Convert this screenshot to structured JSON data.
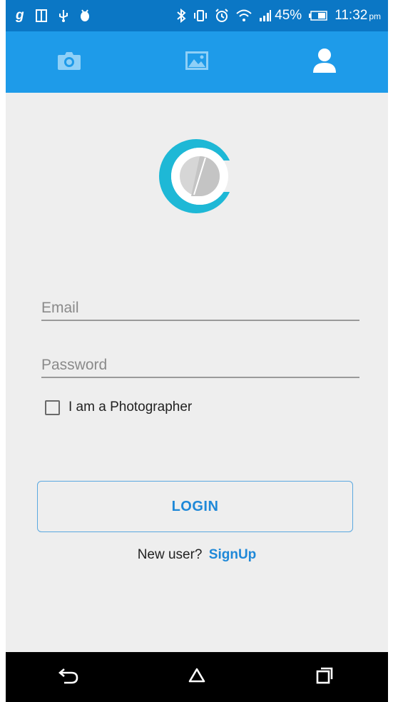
{
  "status_bar": {
    "carrier_glyph": "g",
    "battery": "45%",
    "time": "11:32",
    "ampm": "pm"
  },
  "tabs": [
    {
      "name": "camera",
      "icon": "camera-icon"
    },
    {
      "name": "gallery",
      "icon": "image-icon"
    },
    {
      "name": "profile",
      "icon": "person-icon",
      "active": true
    }
  ],
  "logo": {
    "icon": "app-logo",
    "ring_color": "#1eb8d6"
  },
  "form": {
    "email_placeholder": "Email",
    "password_placeholder": "Password",
    "photographer_label": "I am a Photographer",
    "login_label": "LOGIN",
    "signup_prompt": "New user?",
    "signup_link": "SignUp"
  },
  "nav": [
    {
      "icon": "back-icon"
    },
    {
      "icon": "home-icon"
    },
    {
      "icon": "recents-icon"
    }
  ],
  "colors": {
    "status_bar": "#0b77c5",
    "tab_bar": "#1e9be9",
    "background": "#eeeeee",
    "accent": "#1e88d8"
  }
}
